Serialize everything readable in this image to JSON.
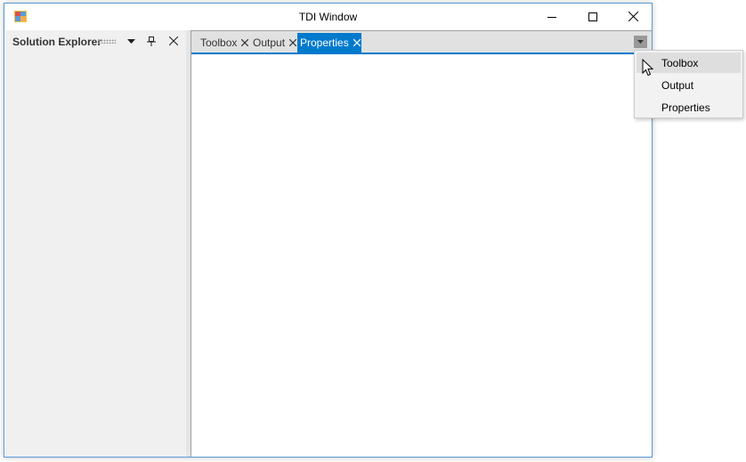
{
  "window": {
    "title": "TDI Window",
    "accent_color": "#007acc",
    "border_color": "#5b9bd5",
    "icons": {
      "app": "app-icon",
      "minimize": "minimize-icon",
      "maximize": "maximize-icon",
      "close": "close-icon"
    }
  },
  "left_panel": {
    "title": "Solution Explorer",
    "icons": {
      "menu": "chevron-down-icon",
      "pin": "pin-icon",
      "close": "close-icon"
    }
  },
  "tabs": [
    {
      "label": "Toolbox",
      "active": false
    },
    {
      "label": "Output",
      "active": false
    },
    {
      "label": "Properties",
      "active": true
    }
  ],
  "tab_dropdown": {
    "icon": "dropdown-arrow-icon"
  },
  "dropdown_menu": {
    "items": [
      {
        "label": "Toolbox",
        "hovered": true
      },
      {
        "label": "Output",
        "hovered": false
      },
      {
        "label": "Properties",
        "hovered": false
      }
    ]
  }
}
